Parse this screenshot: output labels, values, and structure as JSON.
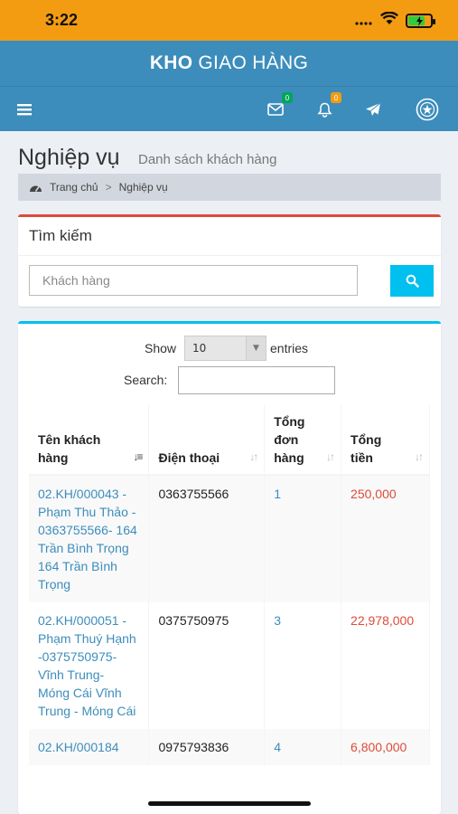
{
  "status_bar": {
    "time": "3:22"
  },
  "app": {
    "brand_bold": "KHO",
    "brand_rest": "GIAO HÀNG"
  },
  "nav": {
    "mail_badge": "0",
    "bell_badge": "0"
  },
  "page": {
    "title": "Nghiệp vụ",
    "subtitle": "Danh sách khách hàng"
  },
  "breadcrumb": {
    "home": "Trang chủ",
    "separator": ">",
    "current": "Nghiệp vụ"
  },
  "search_panel": {
    "title": "Tìm kiếm",
    "customer_placeholder": "Khách hàng"
  },
  "table_controls": {
    "show_label": "Show",
    "entries_value": "10",
    "entries_label": "entries",
    "search_label": "Search:"
  },
  "table": {
    "headers": {
      "name": "Tên khách hàng",
      "phone": "Điện thoại",
      "orders": "Tổng đơn hàng",
      "total": "Tổng tiền"
    },
    "rows": [
      {
        "name": "02.KH/000043 - Phạm Thu Thảo - 0363755566- 164 Trần Bình Trọng 164 Trần Bình Trọng",
        "phone": "0363755566",
        "orders": "1",
        "total": "250,000"
      },
      {
        "name": "02.KH/000051 - Phạm Thuý Hạnh -0375750975- Vĩnh Trung- Móng Cái Vĩnh Trung - Móng Cái",
        "phone": "0375750975",
        "orders": "3",
        "total": "22,978,000"
      },
      {
        "name": "02.KH/000184",
        "phone": "0975793836",
        "orders": "4",
        "total": "6,800,000"
      }
    ]
  },
  "colors": {
    "status_bar": "#f39c12",
    "header": "#3c8dbc",
    "link": "#3c8dbc",
    "money": "#dd4b39",
    "search_button": "#00c0ef",
    "search_box_border": "#dd4b39",
    "list_box_border": "#00c0ef"
  }
}
